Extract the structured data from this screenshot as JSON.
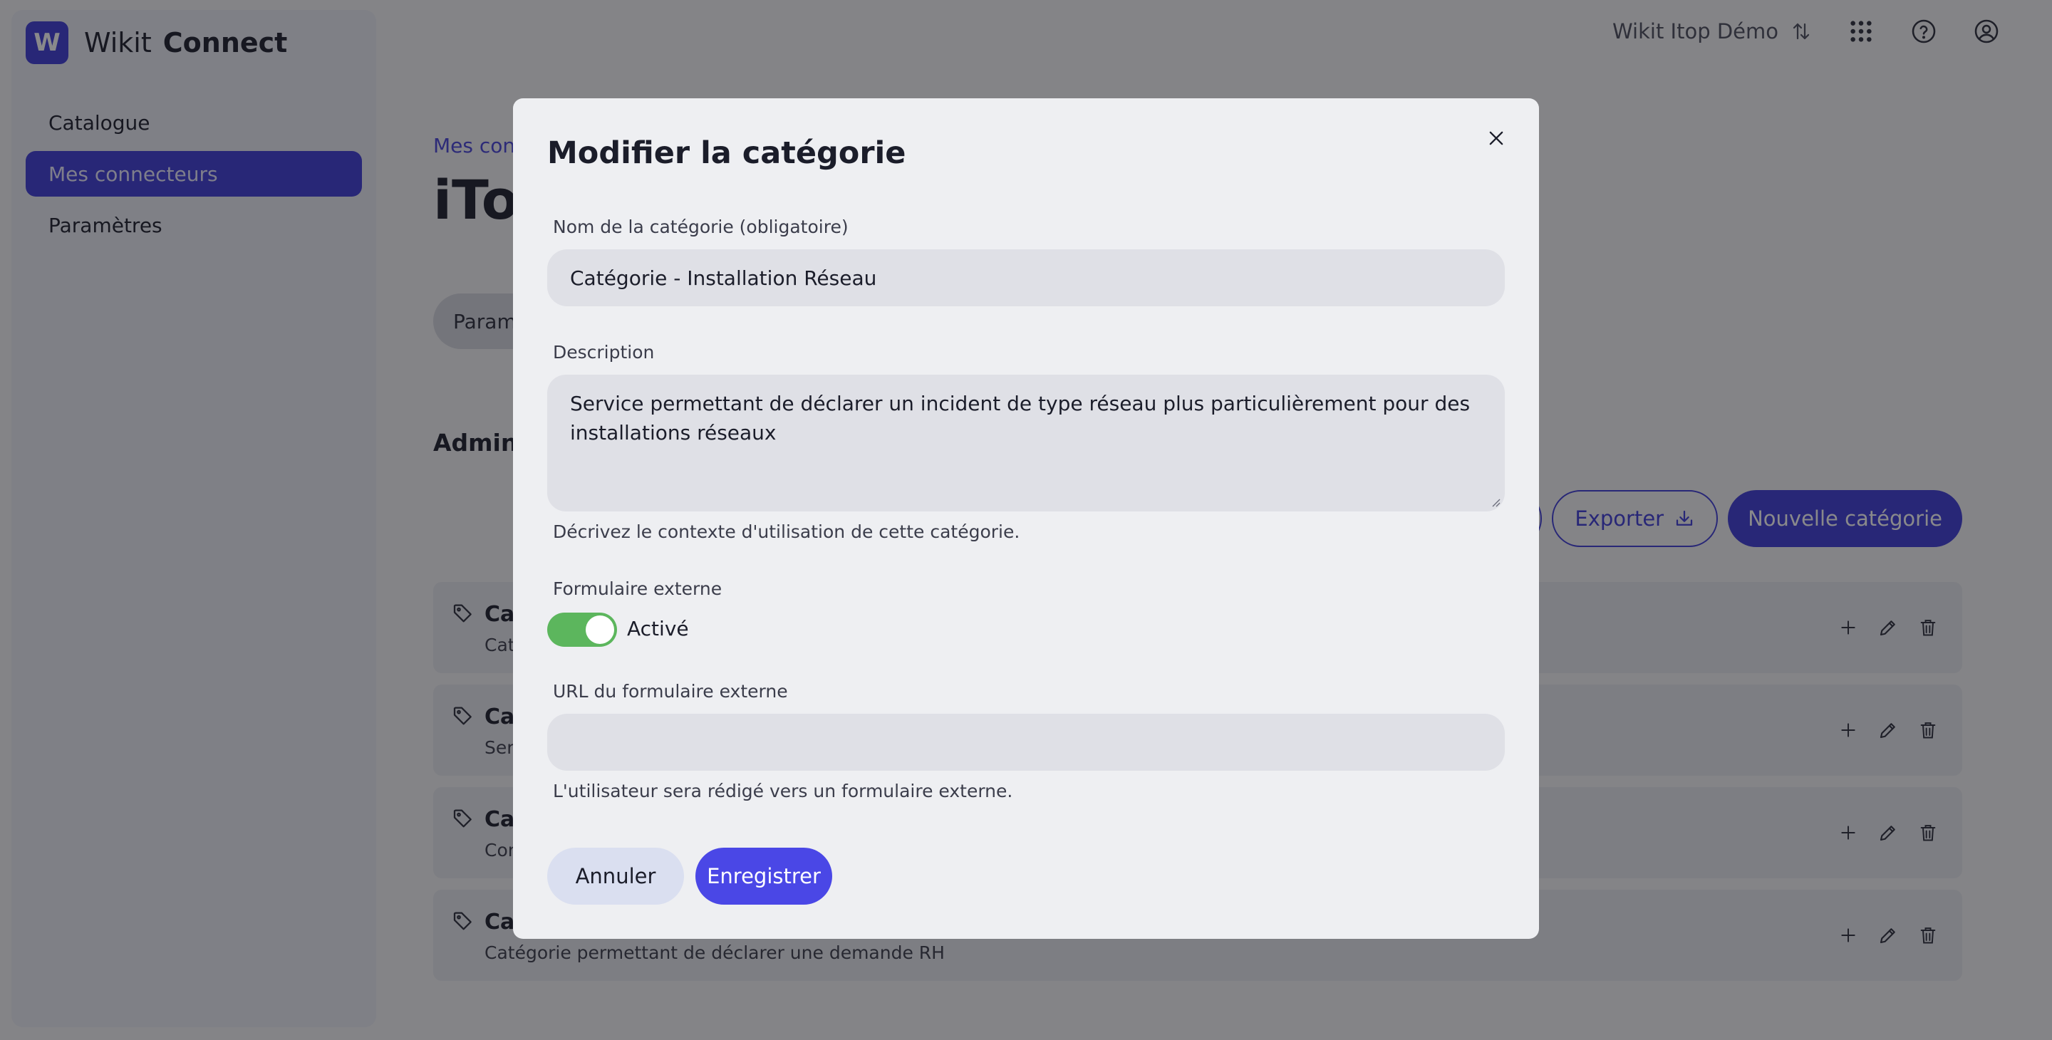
{
  "brand": {
    "logo_letter": "W",
    "name": "Wikit",
    "product": "Connect",
    "accent": "#3d3ad6"
  },
  "sidebar": {
    "items": [
      {
        "label": "Catalogue",
        "active": false
      },
      {
        "label": "Mes connecteurs",
        "active": true
      },
      {
        "label": "Paramètres",
        "active": false
      }
    ]
  },
  "topbar": {
    "workspace": "Wikit Itop Démo",
    "icons": [
      "swap-icon",
      "apps-grid-icon",
      "help-icon",
      "account-icon"
    ]
  },
  "main": {
    "breadcrumb": "Mes conn",
    "title": "iTop",
    "tab": "Parame",
    "section_title": "Adminis",
    "actions": {
      "export": "Exporter",
      "new_category": "Nouvelle catégorie"
    },
    "categories": [
      {
        "name": "Cat",
        "description": "Cate"
      },
      {
        "name": "Cat",
        "description": "Serv"
      },
      {
        "name": "Cat",
        "description": "Con"
      },
      {
        "name": "Cat",
        "description": "Catégorie permettant de déclarer une demande RH"
      }
    ]
  },
  "modal": {
    "title": "Modifier la catégorie",
    "name_label": "Nom de la catégorie (obligatoire)",
    "name_value": "Catégorie - Installation Réseau",
    "description_label": "Description",
    "description_value": "Service permettant de déclarer un incident de type réseau plus particulièrement pour des installations réseaux",
    "description_hint": "Décrivez le contexte d'utilisation de cette catégorie.",
    "external_form_label": "Formulaire externe",
    "external_form_state": "Activé",
    "external_form_enabled": true,
    "toggle_color": "#5cb65d",
    "url_label": "URL du formulaire externe",
    "url_value": "",
    "url_hint": "L'utilisateur sera rédigé vers un formulaire externe.",
    "cancel_label": "Annuler",
    "save_label": "Enregistrer"
  }
}
